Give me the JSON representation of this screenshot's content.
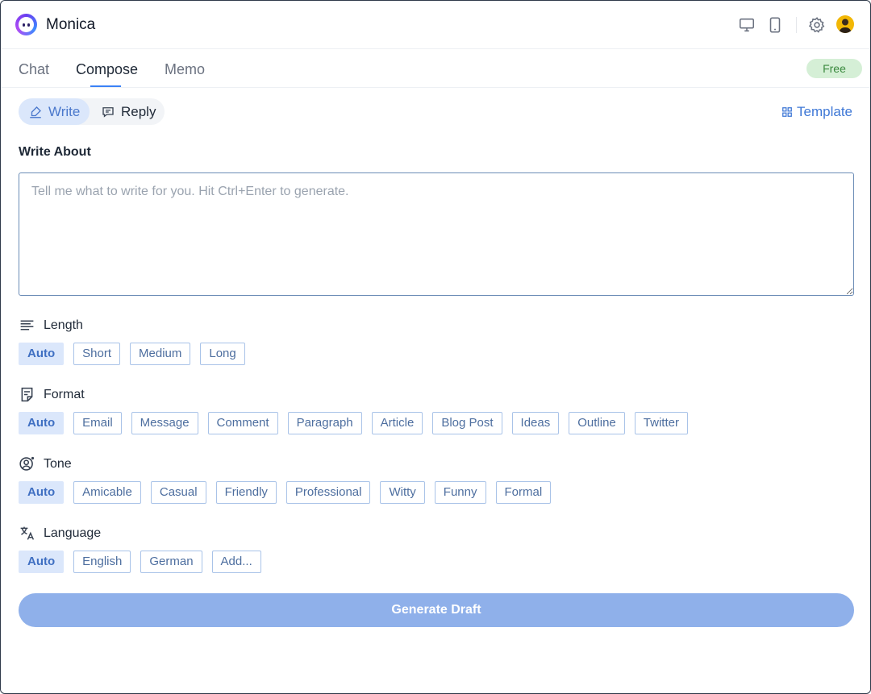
{
  "app": {
    "title": "Monica"
  },
  "header_icons": [
    "desktop-icon",
    "mobile-icon",
    "gear-icon",
    "avatar"
  ],
  "tabs": [
    {
      "label": "Chat",
      "active": false
    },
    {
      "label": "Compose",
      "active": true
    },
    {
      "label": "Memo",
      "active": false
    }
  ],
  "badge": {
    "label": "Free"
  },
  "mode": {
    "write_label": "Write",
    "reply_label": "Reply",
    "template_label": "Template"
  },
  "write_about": {
    "label": "Write About",
    "placeholder": "Tell me what to write for you. Hit Ctrl+Enter to generate.",
    "value": ""
  },
  "length": {
    "label": "Length",
    "options": [
      "Auto",
      "Short",
      "Medium",
      "Long"
    ],
    "selected": "Auto"
  },
  "format": {
    "label": "Format",
    "options": [
      "Auto",
      "Email",
      "Message",
      "Comment",
      "Paragraph",
      "Article",
      "Blog Post",
      "Ideas",
      "Outline",
      "Twitter"
    ],
    "selected": "Auto"
  },
  "tone": {
    "label": "Tone",
    "options": [
      "Auto",
      "Amicable",
      "Casual",
      "Friendly",
      "Professional",
      "Witty",
      "Funny",
      "Formal"
    ],
    "selected": "Auto"
  },
  "language": {
    "label": "Language",
    "options": [
      "Auto",
      "English",
      "German",
      "Add..."
    ],
    "selected": "Auto"
  },
  "generate": {
    "label": "Generate Draft"
  },
  "colors": {
    "accent": "#3b82f6",
    "chip_border": "#a9c3e8",
    "generate_bg": "#8fb0ea",
    "free_bg": "#d5efd6"
  }
}
